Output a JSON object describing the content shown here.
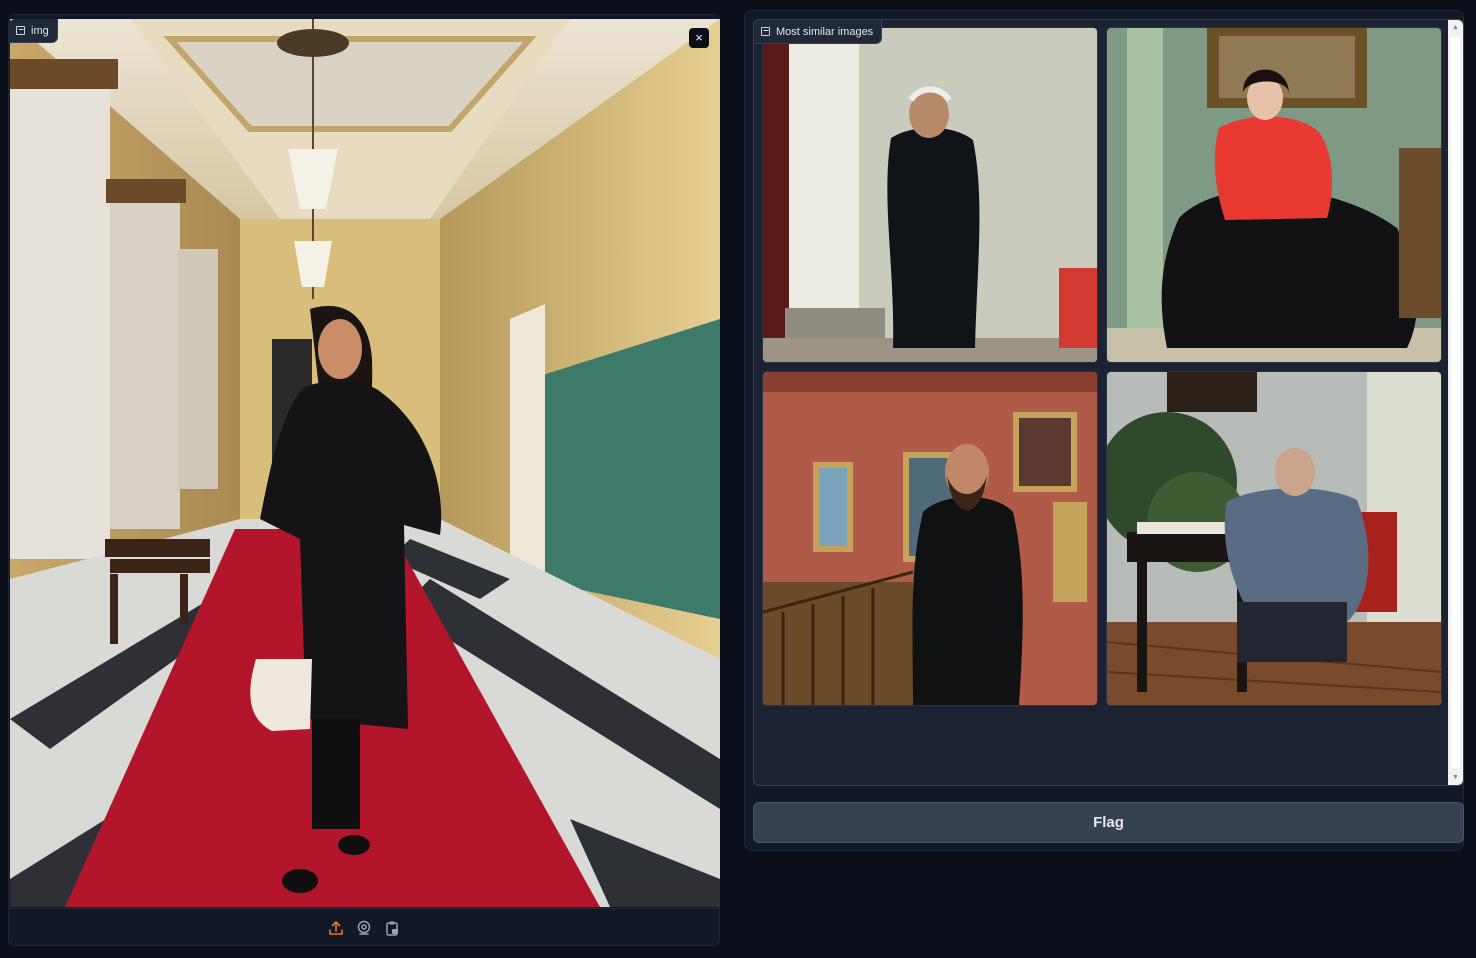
{
  "input_panel": {
    "label": "img",
    "image_icon": "image-icon",
    "close_icon": "close-icon",
    "close_symbol": "×",
    "toolbar": [
      {
        "name": "upload-icon",
        "color": "#f97316"
      },
      {
        "name": "webcam-icon",
        "color": "#9ca3af"
      },
      {
        "name": "clipboard-icon",
        "color": "#9ca3af"
      }
    ]
  },
  "output_panel": {
    "label": "Most similar images",
    "image_icon": "image-icon",
    "results": [
      {
        "name": "result-thumbnail-1"
      },
      {
        "name": "result-thumbnail-2"
      },
      {
        "name": "result-thumbnail-3"
      },
      {
        "name": "result-thumbnail-4"
      }
    ],
    "scroll_up_symbol": "▲",
    "scroll_down_symbol": "▼"
  },
  "flag_button": {
    "label": "Flag"
  },
  "colors": {
    "background": "#0b0f19",
    "panel": "#111827",
    "button": "#374151",
    "accent": "#f97316"
  }
}
